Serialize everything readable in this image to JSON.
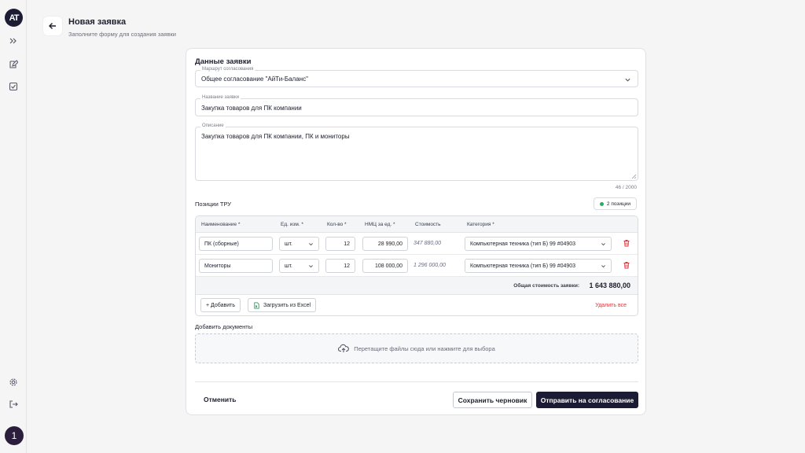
{
  "sidebar": {
    "logo_text": "AT",
    "avatar_text": "1",
    "icons": [
      "chevrons-right-icon",
      "edit-icon",
      "checkbox-icon",
      "gear-icon",
      "logout-icon"
    ]
  },
  "header": {
    "title": "Новая заявка",
    "subtitle": "Заполните форму для создания заявки"
  },
  "form": {
    "card_title": "Данные заявки",
    "route": {
      "label": "Маршрут согласования",
      "value": "Общее согласование \"АйТи-Баланс\""
    },
    "name": {
      "label": "Название заявки",
      "value": "Закупка товаров для ПК компании"
    },
    "description": {
      "label": "Описание",
      "value": "Закупка товаров для ПК компании, ПК и мониторы",
      "counter": "46 / 2000"
    }
  },
  "positions": {
    "title": "Позиции ТРУ",
    "badge": "2 позиции",
    "columns": {
      "name": "Наименование *",
      "unit": "Ед. изм. *",
      "qty": "Кол-во *",
      "price": "НМЦ за ед. *",
      "cost": "Стоимость",
      "category": "Категория *"
    },
    "rows": [
      {
        "name": "ПК (сборные)",
        "unit": "шт.",
        "qty": "12",
        "price": "28 990,00",
        "cost": "347 880,00",
        "category": "Компьютерная техника (тип Б) 99 #04903"
      },
      {
        "name": "Мониторы",
        "unit": "шт.",
        "qty": "12",
        "price": "108 000,00",
        "cost": "1 296 000,00",
        "category": "Компьютерная техника (тип Б) 99 #04903"
      }
    ],
    "total_label": "Общая стоимость заявки:",
    "total_value": "1 643 880,00",
    "add_label": "+ Добавить",
    "excel_label": "Загрузить из Excel",
    "delete_all_label": "Удалить все"
  },
  "documents": {
    "title": "Добавить документы",
    "dropzone_text": "Перетащите файлы сюда или нажмите для выбора"
  },
  "actions": {
    "cancel": "Отменить",
    "draft": "Сохранить черновик",
    "submit": "Отправить на согласование"
  },
  "colors": {
    "accent_dark": "#1b1c33",
    "danger": "#d8383b",
    "success": "#22b064"
  }
}
